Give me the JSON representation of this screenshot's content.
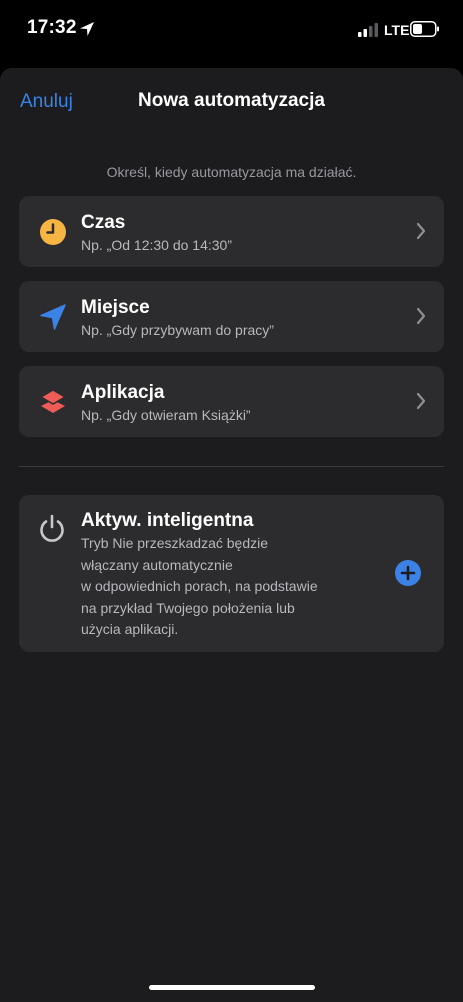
{
  "status": {
    "time": "17:32",
    "network": "LTE"
  },
  "nav": {
    "cancel": "Anuluj",
    "title": "Nowa automatyzacja"
  },
  "subtitle": "Określ, kiedy automatyzacja ma działać.",
  "triggers": [
    {
      "label": "Czas",
      "desc": "Np. „Od 12:30 do 14:30”",
      "icon": "clock-icon",
      "color": "#f7b543"
    },
    {
      "label": "Miejsce",
      "desc": "Np. „Gdy przybywam do pracy”",
      "icon": "location-arrow-icon",
      "color": "#3b82e6"
    },
    {
      "label": "Aplikacja",
      "desc": "Np. „Gdy otwieram Książki”",
      "icon": "app-layers-icon",
      "color": "#ef5b56"
    }
  ],
  "smart": {
    "label": "Aktyw. inteligentna",
    "desc": "Tryb Nie przeszkadzać będzie\nwłączany automatycznie\nw odpowiednich porach, na podstawie\nna przykład Twojego położenia lub\nużycia aplikacji.",
    "icon": "power-icon"
  },
  "colors": {
    "accent": "#3b82e6",
    "sheet": "#1c1c1e",
    "card": "#2c2c2e"
  }
}
